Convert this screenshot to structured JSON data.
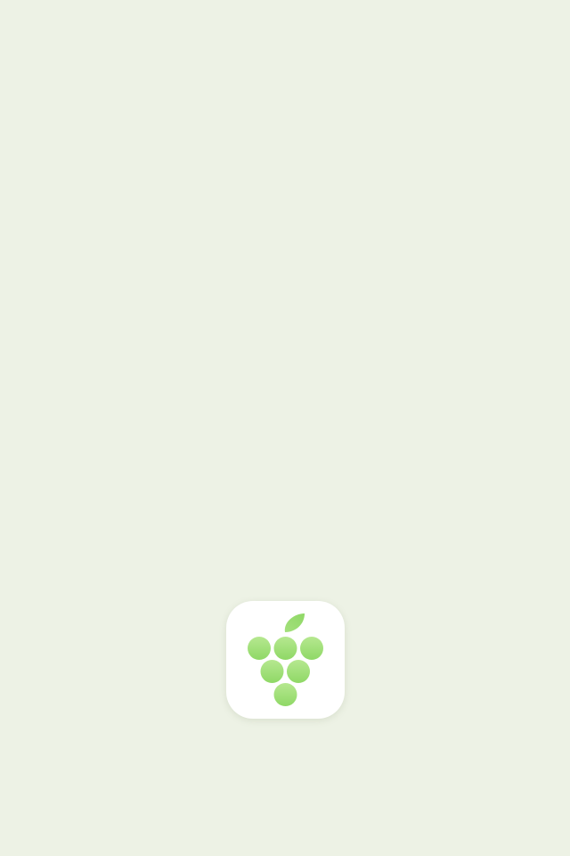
{
  "screen": {
    "type": "splash",
    "background_color": "#edf2e5"
  },
  "app_icon": {
    "icon": "grape-bunch-icon",
    "tile_color": "#ffffff",
    "grape_color_light": "#b6e890",
    "grape_color_dark": "#8fd866",
    "leaf_color": "#9adb72"
  }
}
